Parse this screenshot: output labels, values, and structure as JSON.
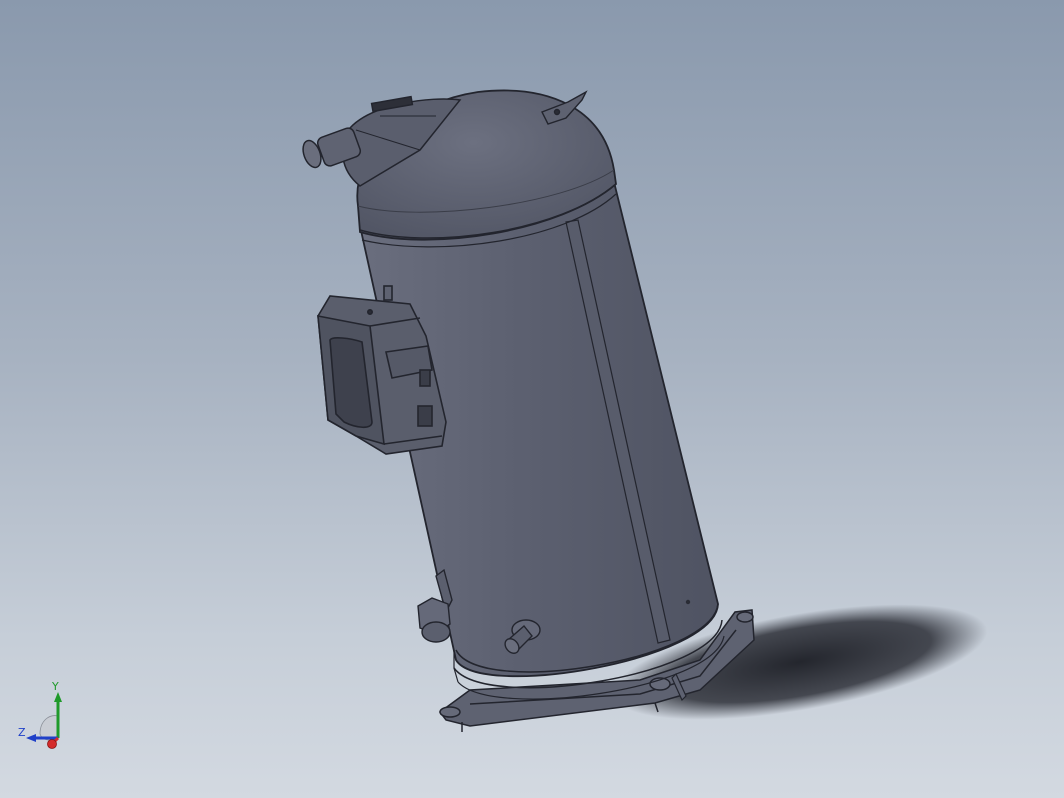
{
  "viewport": {
    "background_top": "#8a99ad",
    "background_bottom": "#d3d9e1"
  },
  "model": {
    "icon": "scroll-compressor-model",
    "body_color": "#5d6170",
    "edge_color": "#23252e"
  },
  "triad": {
    "x_axis_color": "#d42a2a",
    "y_axis_color": "#1f9a2a",
    "z_axis_color": "#2040c8",
    "y_label": "Y",
    "z_label": "Z"
  }
}
